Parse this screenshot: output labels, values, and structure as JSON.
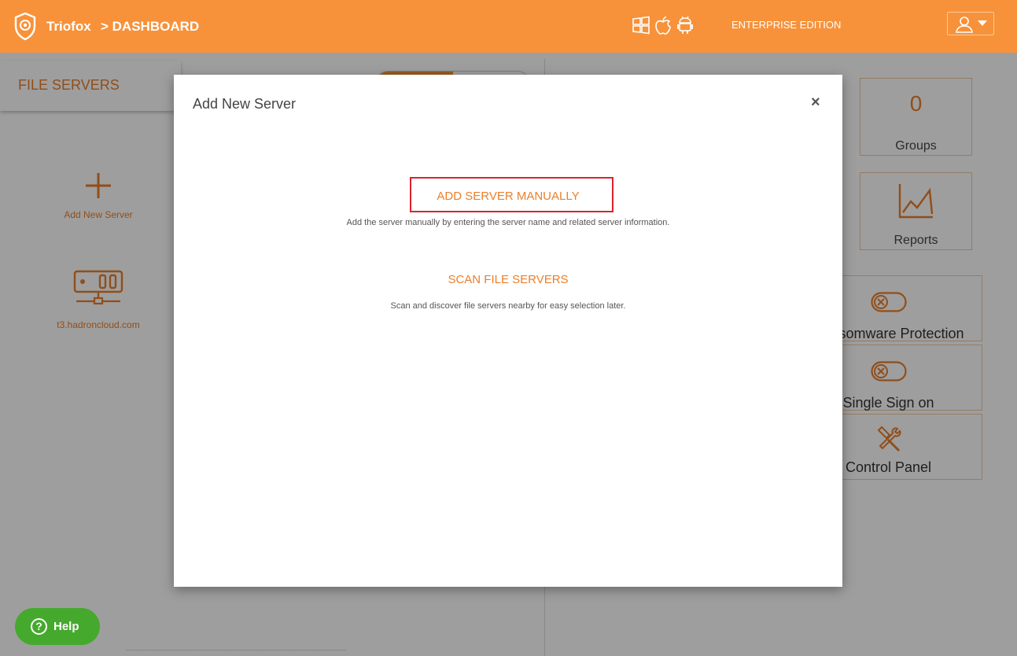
{
  "header": {
    "brand": "Triofox",
    "breadcrumb": "> DASHBOARD",
    "edition": "ENTERPRISE EDITION",
    "platform_icons": [
      "windows-icon",
      "apple-icon",
      "android-icon"
    ],
    "brand_color": "#f7923a"
  },
  "left_pane": {
    "title": "FILE SERVERS",
    "add_tile_label": "Add New Server",
    "server_label": "t3.hadroncloud.com"
  },
  "right_pane": {
    "groups": {
      "count": "0",
      "label": "Groups"
    },
    "reports": {
      "label": "Reports"
    },
    "ransomware": {
      "label": "Ransomware Protection"
    },
    "sso": {
      "label": "Single Sign on"
    },
    "control_panel": {
      "label": "Control Panel"
    }
  },
  "modal": {
    "title": "Add New Server",
    "close": "×",
    "option_manual": {
      "title": "ADD SERVER MANUALLY",
      "description": "Add the server manually by entering the server name and related server information."
    },
    "option_scan": {
      "title": "SCAN FILE SERVERS",
      "description": "Scan and discover file servers nearby for easy selection later."
    },
    "highlight_color": "#d9232e"
  },
  "help": {
    "label": "Help",
    "color": "#45a92d"
  }
}
